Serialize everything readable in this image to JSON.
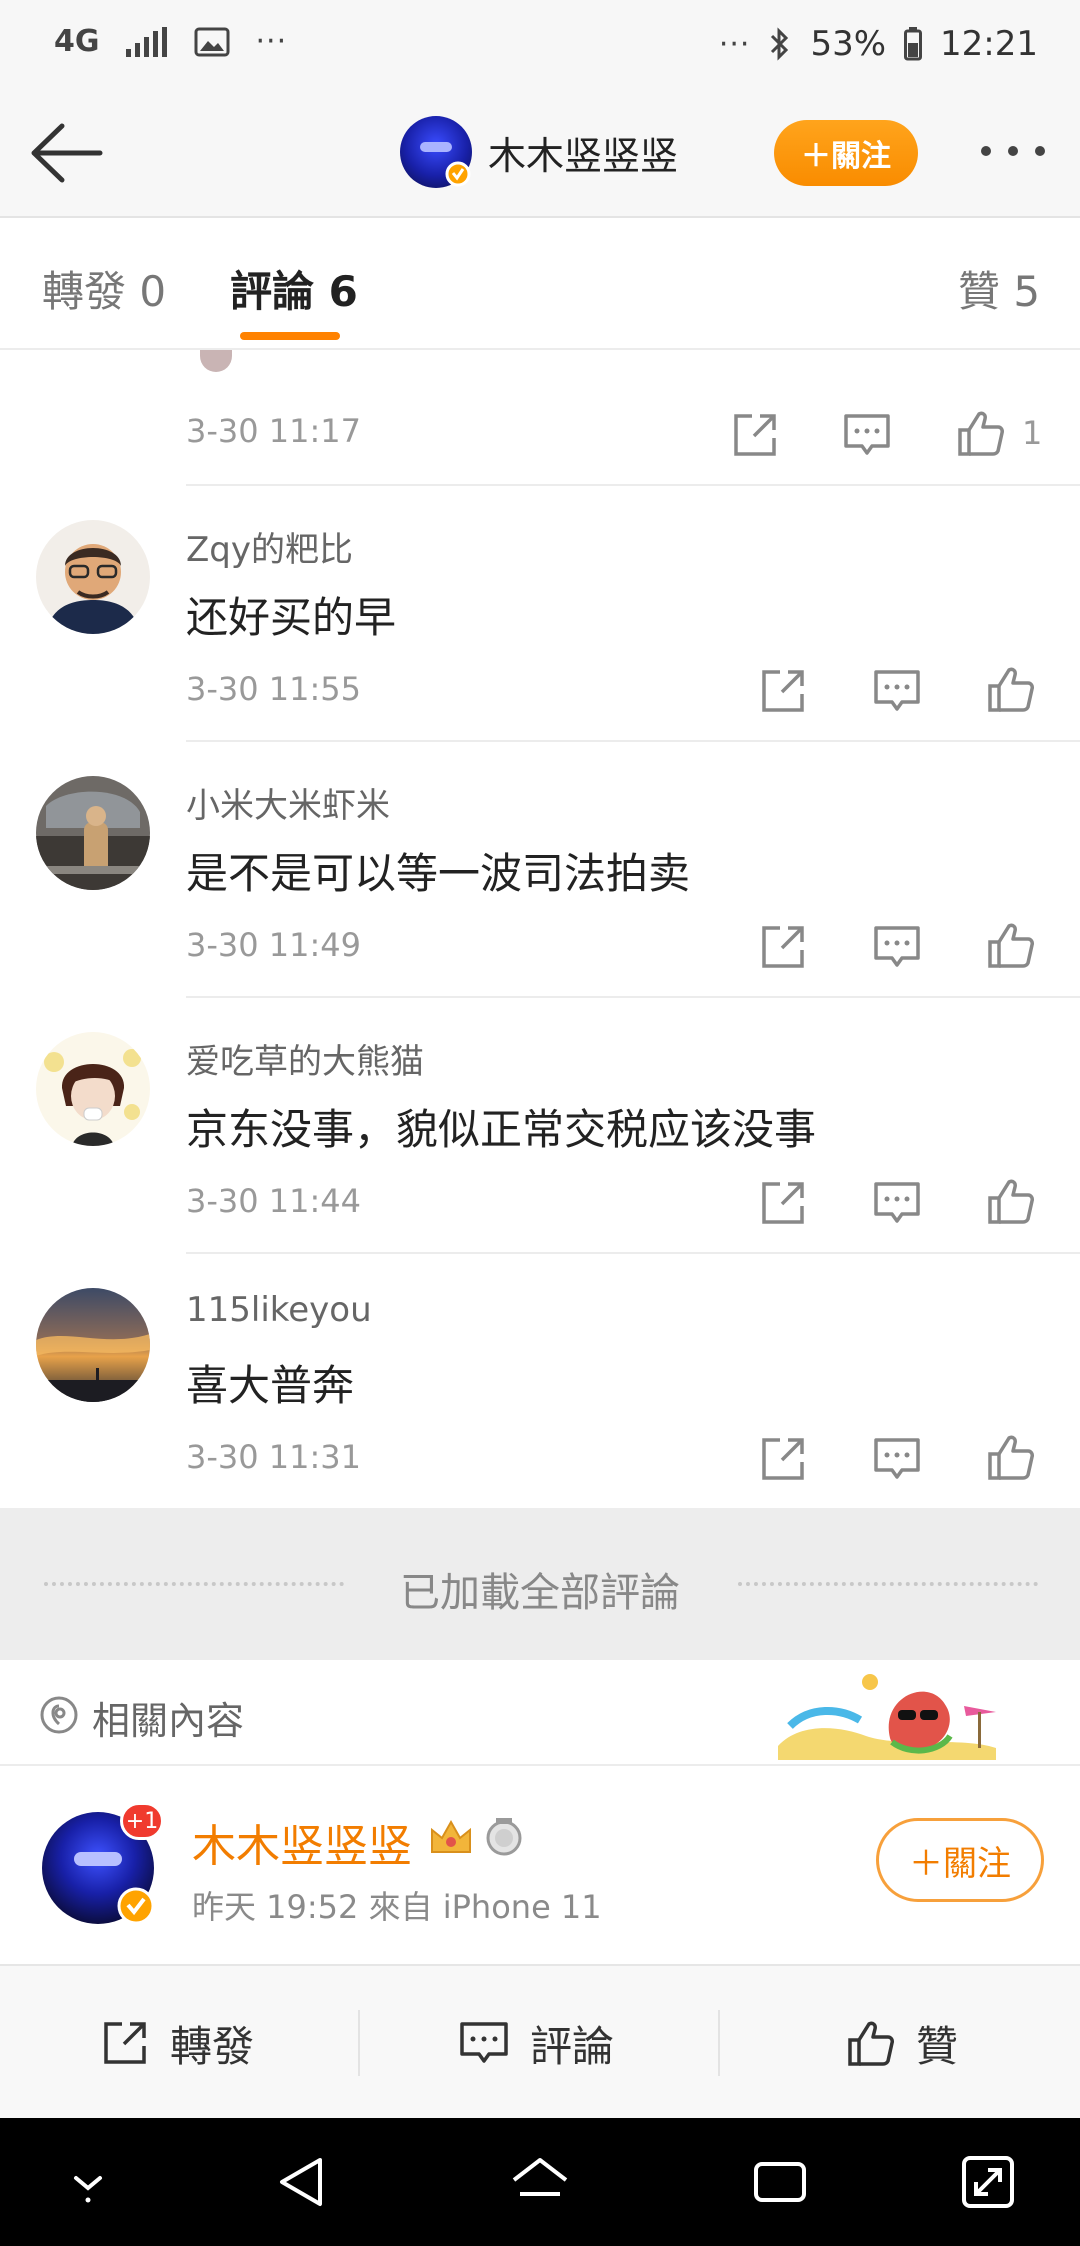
{
  "status_bar": {
    "network": "4G",
    "battery": "53%",
    "time": "12:21",
    "overflow": "···"
  },
  "header": {
    "title": "木木竖竖竖",
    "follow_label": "＋關注"
  },
  "tabs": [
    {
      "label": "轉發 0"
    },
    {
      "label": "評論 6"
    },
    {
      "label": "贊 5"
    }
  ],
  "comments": [
    {
      "name": "",
      "text": "",
      "time": "3-30 11:17",
      "likes": "1"
    },
    {
      "name": "Zqy的粑比",
      "text": "还好买的早",
      "time": "3-30 11:55",
      "likes": ""
    },
    {
      "name": "小米大米虾米",
      "text": "是不是可以等一波司法拍卖",
      "time": "3-30 11:49",
      "likes": ""
    },
    {
      "name": "爱吃草的大熊猫",
      "text": "京东没事，貌似正常交税应该没事",
      "time": "3-30 11:44",
      "likes": ""
    },
    {
      "name": "115likeyou",
      "text": "喜大普奔",
      "time": "3-30 11:31",
      "likes": ""
    }
  ],
  "loaded_all": "已加載全部評論",
  "related": {
    "label": "相關內容"
  },
  "post": {
    "author": "木木竖竖竖",
    "badge": "+1",
    "meta": "昨天 19:52   來自 iPhone 11",
    "follow_label": "＋關注"
  },
  "bottom_bar": {
    "repost": "轉發",
    "comment": "評論",
    "like": "贊"
  },
  "colors": {
    "accent": "#ff8200",
    "name_orange": "#f27d00"
  }
}
